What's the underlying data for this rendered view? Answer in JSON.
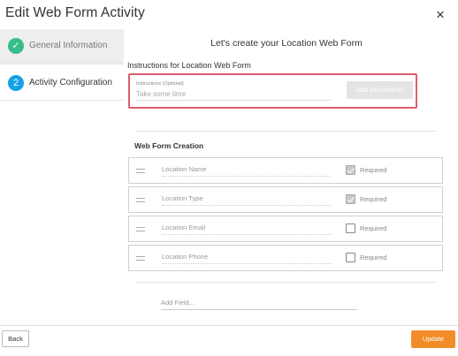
{
  "dialog": {
    "title": "Edit Web Form Activity",
    "close_glyph": "×"
  },
  "sidebar": {
    "steps": [
      {
        "badge": "✓",
        "label": "General Information",
        "state": "completed"
      },
      {
        "badge": "2",
        "label": "Activity Configuration",
        "state": "active"
      }
    ]
  },
  "main": {
    "heading": "Let's create your Location Web Form",
    "instructions": {
      "section_label": "Instructions for Location Web Form",
      "field_label": "Instructions (Optional)",
      "placeholder": "Take some time",
      "add_documents": "Add Documents"
    },
    "web_form": {
      "heading": "Web Form Creation",
      "fields": [
        {
          "name": "Location Name",
          "required_label": "Required",
          "required": true
        },
        {
          "name": "Location Type",
          "required_label": "Required",
          "required": true
        },
        {
          "name": "Location Email",
          "required_label": "Required",
          "required": false
        },
        {
          "name": "Location Phone",
          "required_label": "Required",
          "required": false
        }
      ],
      "add_field": "Add Field..."
    }
  },
  "footer": {
    "back_label": "Back",
    "update_label": "Update"
  },
  "colors": {
    "completed": "#37bd8a",
    "active": "#16a0e6",
    "highlight_border": "#e05b6c",
    "update_button": "#f28c28"
  }
}
